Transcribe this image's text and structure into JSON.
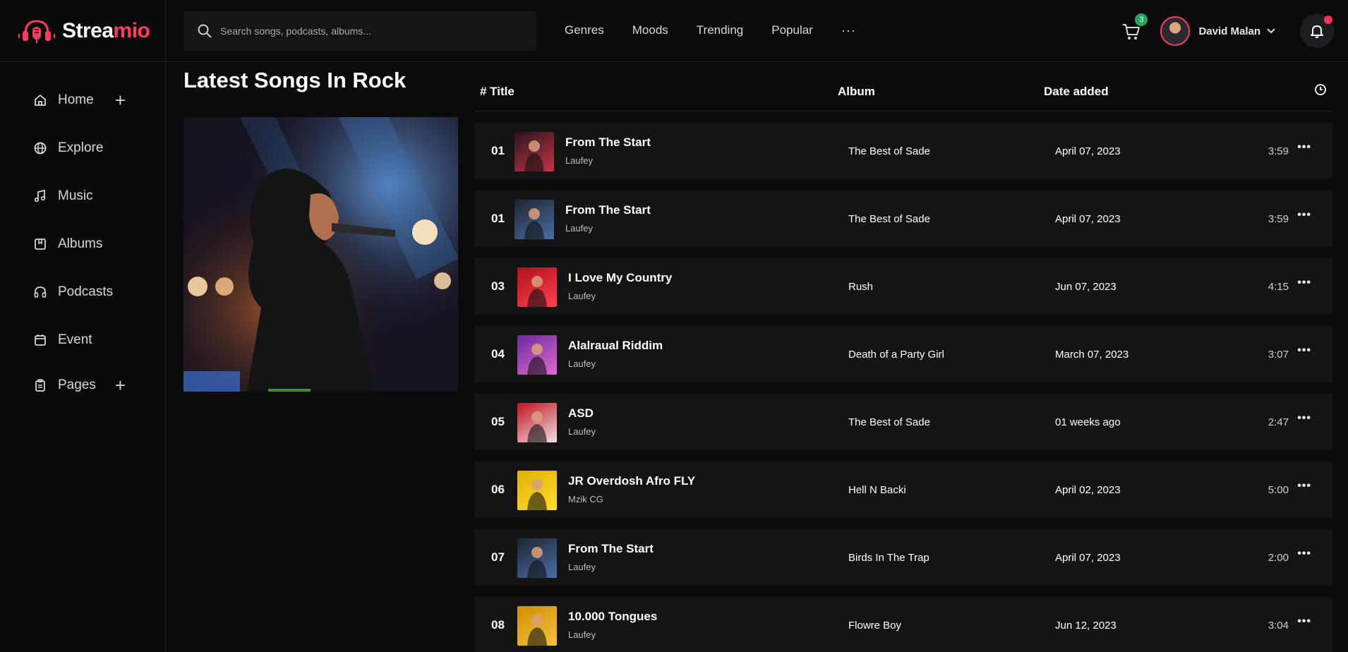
{
  "brand": {
    "part1": "Strea",
    "part2": "mio",
    "accent": "#ff3b5c"
  },
  "sidebar": {
    "items": [
      {
        "label": "Home",
        "icon": "home-icon",
        "expandable": true
      },
      {
        "label": "Explore",
        "icon": "globe-icon",
        "expandable": false
      },
      {
        "label": "Music",
        "icon": "music-note-icon",
        "expandable": false
      },
      {
        "label": "Albums",
        "icon": "album-icon",
        "expandable": false
      },
      {
        "label": "Podcasts",
        "icon": "headphones-icon",
        "expandable": false
      },
      {
        "label": "Event",
        "icon": "calendar-icon",
        "expandable": false
      },
      {
        "label": "Pages",
        "icon": "clipboard-icon",
        "expandable": true
      }
    ]
  },
  "header": {
    "search_placeholder": "Search songs, podcasts, albums...",
    "nav": [
      "Genres",
      "Moods",
      "Trending",
      "Popular"
    ],
    "more": "···",
    "cart_count": "3",
    "user_name": "David Malan"
  },
  "main": {
    "title": "Latest Songs In Rock",
    "columns": {
      "title": "# Title",
      "album": "Album",
      "date": "Date added"
    },
    "rows": [
      {
        "num": "01",
        "title": "From The Start",
        "artist": "Laufey",
        "album": "The Best of Sade",
        "date": "April 07, 2023",
        "duration": "3:59",
        "thumb": [
          "#2a1420",
          "#c53545"
        ]
      },
      {
        "num": "01",
        "title": "From The Start",
        "artist": "Laufey",
        "album": "The Best of Sade",
        "date": "April 07, 2023",
        "duration": "3:59",
        "thumb": [
          "#1e2430",
          "#4a6ea8"
        ]
      },
      {
        "num": "03",
        "title": "I Love My Country",
        "artist": "Laufey",
        "album": "Rush",
        "date": "Jun 07, 2023",
        "duration": "4:15",
        "thumb": [
          "#b0101c",
          "#ff4050"
        ]
      },
      {
        "num": "04",
        "title": "Alalraual Riddim",
        "artist": "Laufey",
        "album": "Death of a Party Girl",
        "date": "March 07, 2023",
        "duration": "3:07",
        "thumb": [
          "#6a2aa0",
          "#e06ad0"
        ]
      },
      {
        "num": "05",
        "title": "ASD",
        "artist": "Laufey",
        "album": "The Best of Sade",
        "date": "01 weeks ago",
        "duration": "2:47",
        "thumb": [
          "#c01020",
          "#f0e0e0"
        ]
      },
      {
        "num": "06",
        "title": "JR Overdosh Afro FLY",
        "artist": "Mzik CG",
        "album": "Hell N Backi",
        "date": "April 02, 2023",
        "duration": "5:00",
        "thumb": [
          "#e0b000",
          "#ffdd30"
        ]
      },
      {
        "num": "07",
        "title": "From The Start",
        "artist": "Laufey",
        "album": "Birds In The Trap",
        "date": "April 07, 2023",
        "duration": "2:00",
        "thumb": [
          "#1e2430",
          "#4a6ea8"
        ]
      },
      {
        "num": "08",
        "title": "10.000 Tongues",
        "artist": "Laufey",
        "album": "Flowre Boy",
        "date": "Jun 12, 2023",
        "duration": "3:04",
        "thumb": [
          "#d09000",
          "#f5c040"
        ]
      }
    ]
  }
}
